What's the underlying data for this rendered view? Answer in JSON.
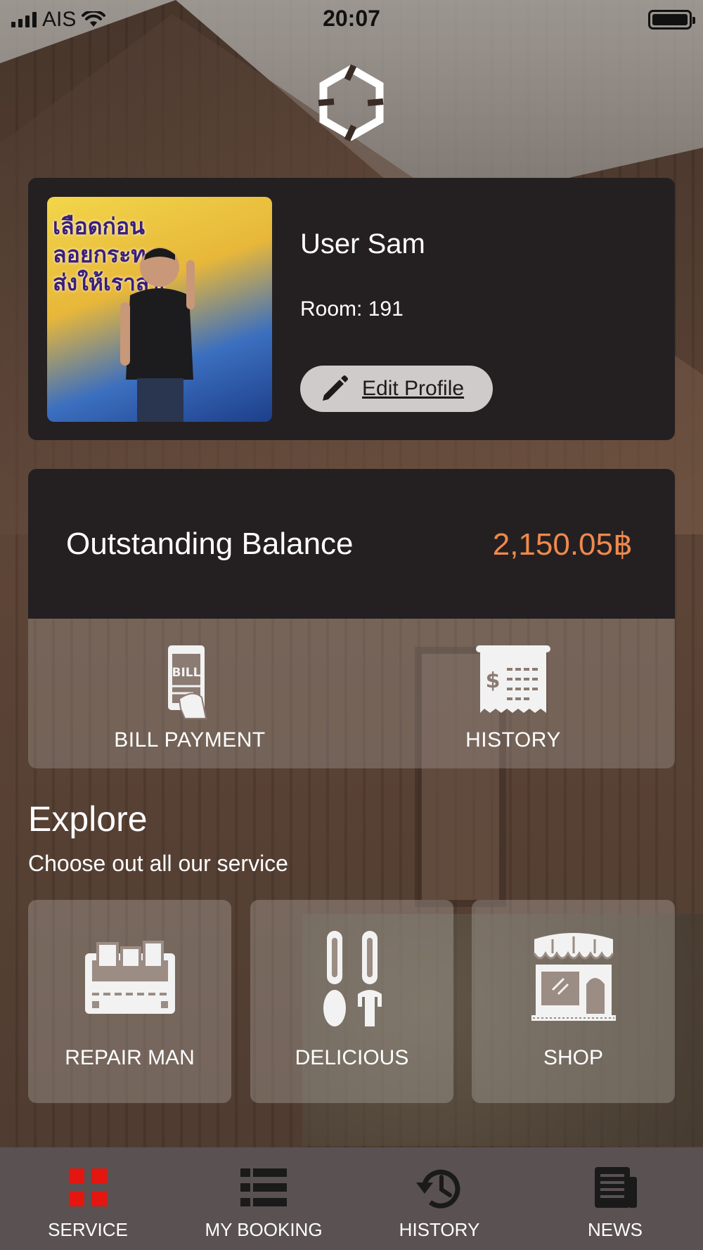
{
  "status_bar": {
    "carrier": "AIS",
    "time": "20:07"
  },
  "profile": {
    "name": "User Sam",
    "room": "Room: 191",
    "edit_label": "Edit Profile",
    "photo_text_line1": "เลือดก่อน",
    "photo_text_line2": "ลอยกระทง",
    "photo_text_line3": "ส่งให้เราสุข"
  },
  "balance": {
    "label": "Outstanding Balance",
    "value": "2,150.05฿",
    "value_color": "#f0894d"
  },
  "bill_actions": [
    {
      "label": "BILL PAYMENT",
      "icon": "bill-phone-icon"
    },
    {
      "label": "HISTORY",
      "icon": "receipt-icon"
    }
  ],
  "explore": {
    "title": "Explore",
    "subtitle": "Choose out all our service"
  },
  "services": [
    {
      "label": "REPAIR MAN",
      "icon": "toolbox-icon"
    },
    {
      "label": "DELICIOUS",
      "icon": "spoon-fork-icon"
    },
    {
      "label": "SHOP",
      "icon": "storefront-icon"
    }
  ],
  "tabs": [
    {
      "label": "SERVICE",
      "icon": "grid-icon",
      "active": true,
      "color": "#e5150f"
    },
    {
      "label": "MY BOOKING",
      "icon": "list-icon",
      "active": false
    },
    {
      "label": "HISTORY",
      "icon": "history-icon",
      "active": false
    },
    {
      "label": "NEWS",
      "icon": "newspaper-icon",
      "active": false
    }
  ]
}
